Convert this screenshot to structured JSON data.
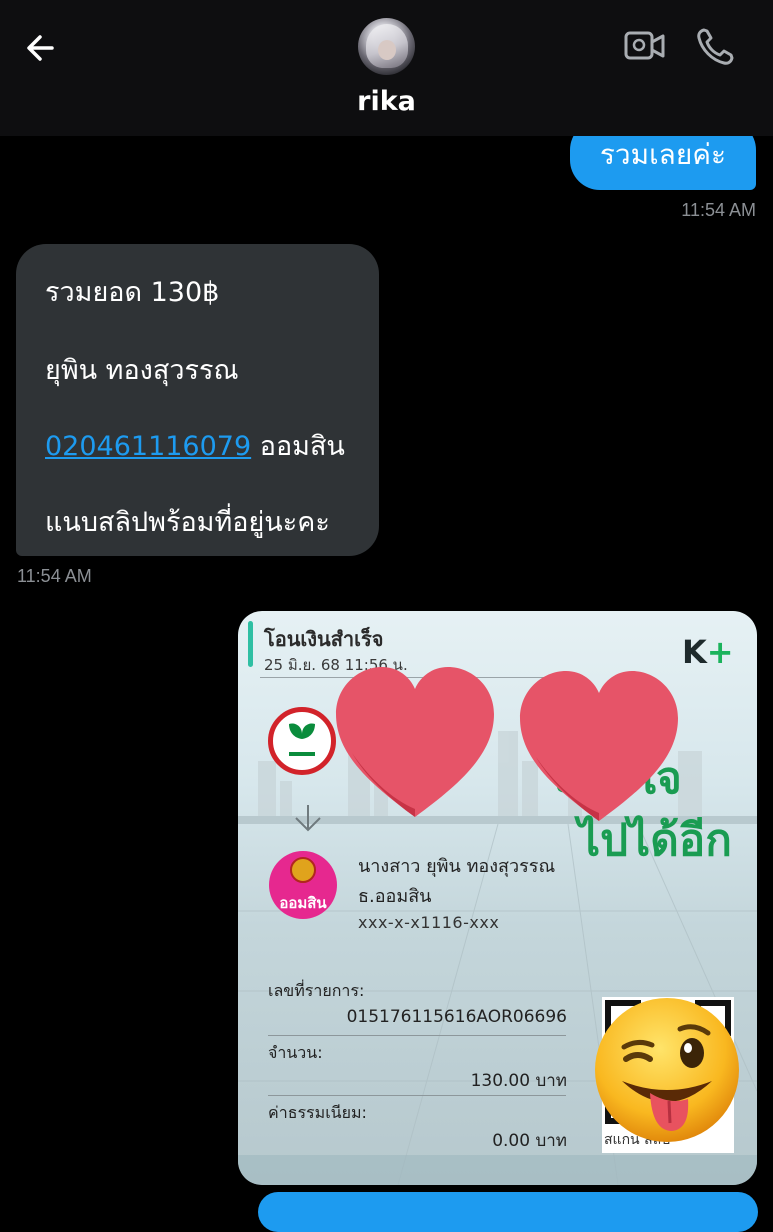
{
  "header": {
    "contact_name": "rika",
    "icons": {
      "back": "back-arrow-icon",
      "video": "video-camera-icon",
      "call": "phone-icon"
    }
  },
  "messages": {
    "outgoing_1": {
      "text": "รวมเลยค่ะ",
      "time": "11:54 AM"
    },
    "incoming_1": {
      "line1": "รวมยอด 130฿",
      "line2": "ยุพิน ทองสุวรรณ",
      "account_link": "020461116079",
      "bank": " ออมสิน",
      "line4": "แนบสลิปพร้อมที่อยู่นะคะ",
      "time": "11:54 AM"
    }
  },
  "slip": {
    "title": "โอนเงินสำเร็จ",
    "date": "25 มิ.ย. 68  11:56 น.",
    "brand": "K",
    "brand_plus": "+",
    "recipient_name": "นางสาว ยุพิน ทองสุวรรณ",
    "recipient_bank": "ธ.ออมสิน",
    "recipient_account": "xxx-x-x1116-xxx",
    "gsb_logo_text": "ออมสิน",
    "ref_label": "เลขที่รายการ:",
    "ref_value": "015176115616AOR06696",
    "amount_label": "จำนวน:",
    "amount_value": "130.00 บาท",
    "fee_label": "ค่าธรรมเนียม:",
    "fee_value": "0.00 บาท",
    "promo_line1": "ะทับใจ",
    "promo_line2": "ไปได้อีก",
    "qr_caption": "สแกน        สลิป"
  },
  "colors": {
    "accent": "#1d9bf0",
    "incoming_bubble": "#2f3336",
    "timestamp": "#8b8f94"
  }
}
